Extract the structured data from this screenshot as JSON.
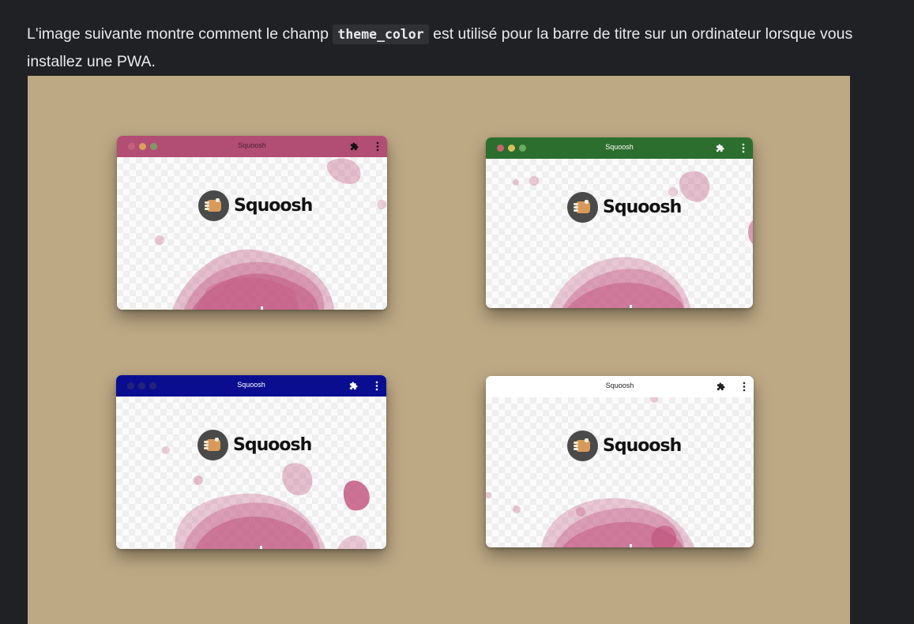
{
  "paragraph": {
    "before": "L'image suivante montre comment le champ ",
    "code": "theme_color",
    "after": " est utilisé pour la barre de titre sur un ordinateur lorsque vous installez une PWA."
  },
  "figure": {
    "background": "#bea985",
    "windows": [
      {
        "title": "Squoosh",
        "logo_text": "Squoosh",
        "titlebar_color": "#b24d74",
        "title_text_color": "#4a1f30",
        "dot_colors": [
          "#c9607f",
          "#d6a35a",
          "#7d9a62"
        ],
        "icon_color": "#111111"
      },
      {
        "title": "Squoosh",
        "logo_text": "Squoosh",
        "titlebar_color": "#2c6e2e",
        "title_text_color": "#ffffff",
        "dot_colors": [
          "#c6656e",
          "#d8c060",
          "#6caa62"
        ],
        "icon_color": "#ffffff"
      },
      {
        "title": "Squoosh",
        "logo_text": "Squoosh",
        "titlebar_color": "#0b0d91",
        "title_text_color": "#ffffff",
        "dot_colors": [
          "#23237a",
          "#23237a",
          "#23237a"
        ],
        "icon_color": "#ffffff"
      },
      {
        "title": "Squoosh",
        "logo_text": "Squoosh",
        "titlebar_color": "#ffffff",
        "title_text_color": "#202124",
        "dot_colors": [
          "#ffffff",
          "#ffffff",
          "#ffffff"
        ],
        "icon_color": "#202124"
      }
    ],
    "icons": {
      "extension": "puzzle-icon",
      "menu": "kebab-menu-icon",
      "window_controls": "traffic-light-dots"
    }
  }
}
